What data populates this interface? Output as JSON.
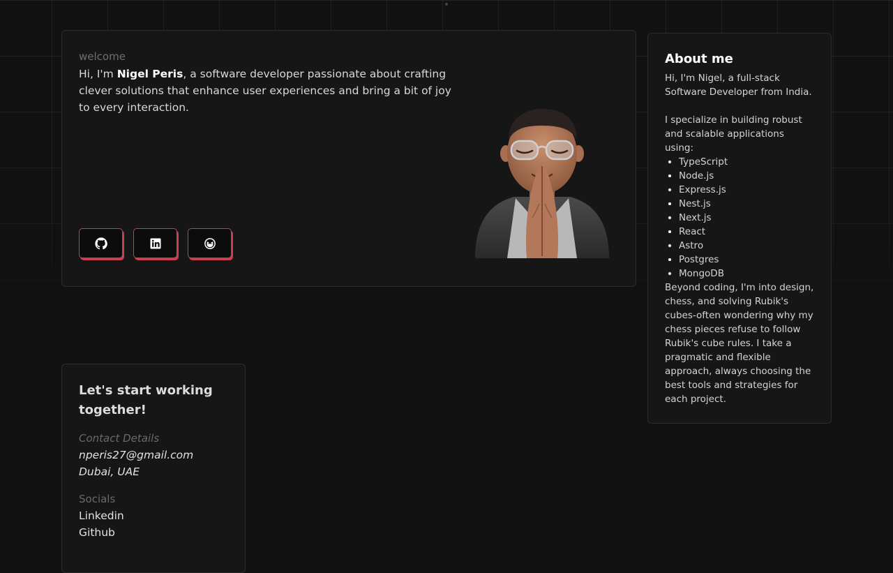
{
  "hero": {
    "welcome": "welcome",
    "intro_prefix": "Hi, I'm ",
    "intro_name": "Nigel Peris",
    "intro_suffix": ", a software developer passionate about crafting clever solutions that enhance user experiences and bring a bit of joy to every interaction.",
    "social_icons": [
      "github-icon",
      "linkedin-icon",
      "laughing-emoji-icon"
    ]
  },
  "about": {
    "title": "About me",
    "intro": "Hi, I'm Nigel, a full-stack Software Developer from India.",
    "skills_intro": "I specialize in building robust and scalable applications using:",
    "skills": [
      "TypeScript",
      "Node.js",
      "Express.js",
      "Nest.js",
      "Next.js",
      "React",
      "Astro",
      "Postgres",
      "MongoDB"
    ],
    "outro": "Beyond coding, I'm into design, chess, and solving Rubik's cubes-often wondering why my chess pieces refuse to follow Rubik's cube rules. I take a pragmatic and flexible approach, always choosing the best tools and strategies for each project."
  },
  "contact": {
    "title": "Let's start working together!",
    "details_label": "Contact Details",
    "email": "nperis27@gmail.com",
    "location": "Dubai, UAE",
    "socials_label": "Socials",
    "socials": [
      "Linkedin",
      "Github"
    ]
  },
  "colors": {
    "background": "#111111",
    "card": "#161616",
    "accent": "#c8404e"
  }
}
